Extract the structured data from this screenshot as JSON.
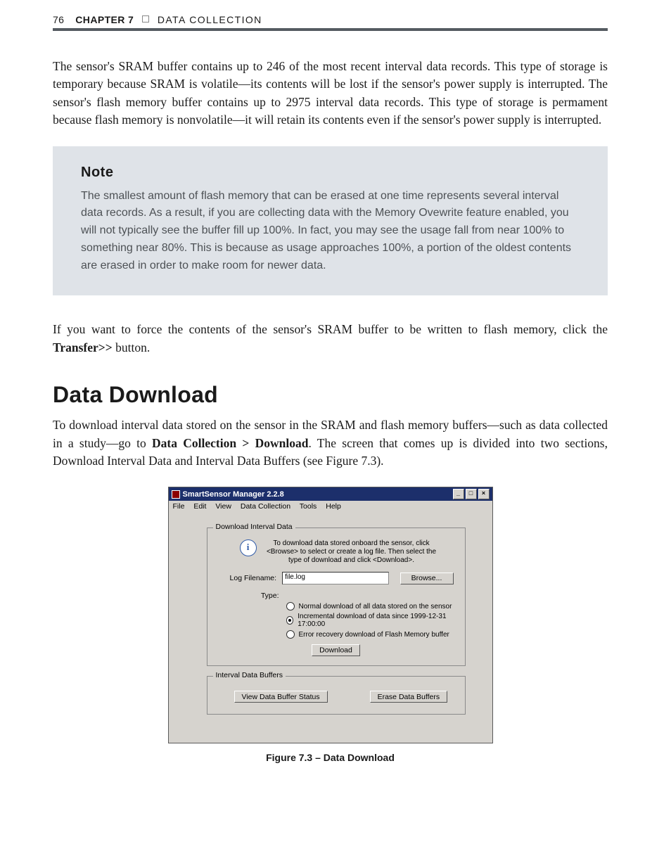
{
  "header": {
    "page_number": "76",
    "chapter_label": "CHAPTER 7",
    "chapter_rest": "DATA COLLECTION"
  },
  "para1": "The sensor's SRAM buffer contains up to 246 of the most recent interval data records. This type of storage is temporary because SRAM is volatile—its contents will be lost if the sensor's power supply is interrupted. The sensor's flash memory buffer contains up to 2975 interval data records. This type of storage is permament because flash memory is nonvolatile—it will retain its contents even if the sensor's power supply is interrupted.",
  "note": {
    "title": "Note",
    "body": "The smallest amount of flash memory that can be erased at one time represents several interval data records. As a result, if you are collecting data with the Memory Ovewrite feature enabled, you will not typically see the buffer fill up 100%. In fact, you may see the usage fall from near 100% to something near 80%. This is because as usage approaches 100%, a portion of the oldest contents are erased in order to make room for newer data."
  },
  "para2_a": "If you want to force the contents of the sensor's SRAM buffer to be written to flash memory, click the ",
  "para2_bold": "Transfer>>",
  "para2_b": " button.",
  "heading": "Data Download",
  "para3_a": "To download interval data stored on the sensor in the SRAM and flash memory buffers—such as data collected in a study—go to ",
  "para3_bold": "Data Collection > Download",
  "para3_b": ". The screen that comes up is divided into two sections, Download Interval Data and Interval Data Buffers (see Figure 7.3).",
  "app": {
    "title": "SmartSensor Manager 2.2.8",
    "menu": {
      "file": "File",
      "edit": "Edit",
      "view": "View",
      "dc": "Data Collection",
      "tools": "Tools",
      "help": "Help"
    },
    "group1": {
      "legend": "Download Interval Data",
      "info": "To download data stored onboard the sensor, click <Browse> to select or create a log file. Then select the type of download and click <Download>.",
      "log_label": "Log Filename:",
      "log_value": "file.log",
      "browse": "Browse...",
      "type_label": "Type:",
      "radio1": "Normal download of all data stored on the sensor",
      "radio2": "Incremental download of data since 1999-12-31 17:00:00",
      "radio3": "Error recovery download of Flash Memory buffer",
      "download": "Download"
    },
    "group2": {
      "legend": "Interval Data Buffers",
      "view": "View Data Buffer Status",
      "erase": "Erase Data Buffers"
    }
  },
  "figure_caption": "Figure 7.3 – Data Download"
}
